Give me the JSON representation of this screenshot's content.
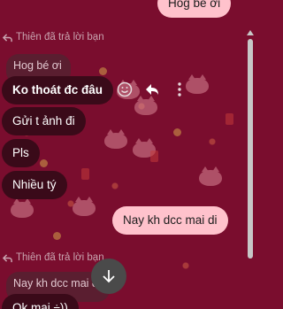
{
  "top_partial_message": "Hog bé ơi",
  "reply_1": {
    "header": "Thiên đã trả lời bạn",
    "quoted": "Hog bé ơi"
  },
  "incoming": [
    "Ko thoát đc đâu",
    "Gửi t ảnh đi",
    "Pls",
    "Nhiều tý"
  ],
  "outgoing": {
    "message": "Nay kh dcc mai di"
  },
  "reply_2": {
    "header": "Thiên đã trả lời bạn",
    "quoted": "Nay kh dcc mai di",
    "message": "Ok mai ÷))"
  },
  "icons": {
    "react": "smiley-icon",
    "reply": "reply-arrow-icon",
    "more": "vertical-ellipsis-icon",
    "scroll_down": "arrow-down-icon"
  },
  "colors": {
    "background": "#7a0d2e",
    "incoming_bubble": "#3a0a19",
    "outgoing_bubble": "#ffc2cc"
  }
}
